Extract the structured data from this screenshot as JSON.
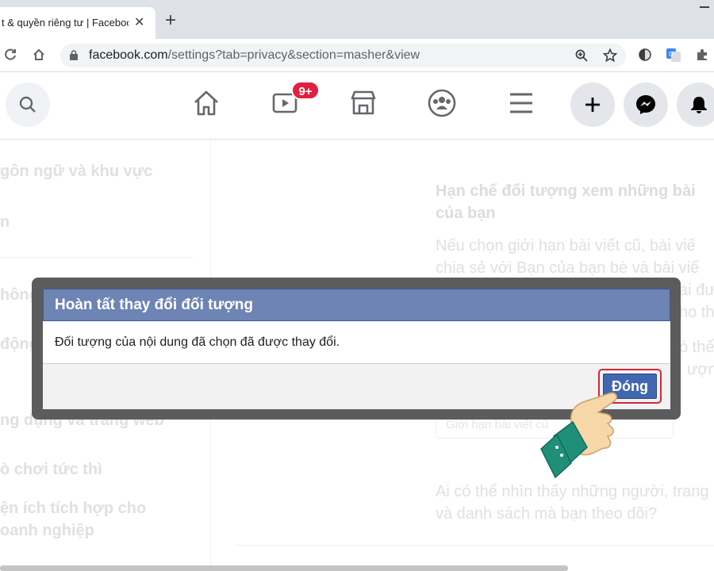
{
  "browser": {
    "tab_title": "t & quyền riêng tư | Facebook",
    "new_tab": "+",
    "url_host": "facebook.com",
    "url_path": "/settings?tab=privacy&section=masher&view"
  },
  "header": {
    "badge": "9+"
  },
  "sidebar": {
    "items": [
      "gôn ngữ và khu vực",
      "n",
      "hông",
      "động",
      "ng dụng và trang web",
      "ò chơi tức thì",
      "ện ích tích hợp cho",
      "oanh nghiệp"
    ]
  },
  "main": {
    "heading_line1": "Hạn chế đối tượng xem những bài",
    "heading_line2": "của bạn",
    "desc_line1": "Nếu chọn giới hạn bài viết cũ, bài viế",
    "desc_line2": "chia sẻ với Bạn của bạn bè và bài viế",
    "frag1": "ai đư",
    "frag2": "ho th",
    "frag3": "ó thể",
    "frag4": "ượn",
    "select_label": "Giới hạn bài viết cũ",
    "question_line1": "Ai có thể nhìn thấy những người, trang",
    "question_line2": "và danh sách mà bạn theo dõi?"
  },
  "dialog": {
    "title": "Hoàn tất thay đổi đối tượng",
    "message": "Đối tượng của nội dung đã chọn đã được thay đổi.",
    "close_label": "Đóng"
  },
  "colors": {
    "dialog_header": "#6d84b4",
    "button": "#4267b2",
    "highlight": "#d4283a",
    "badge": "#e41e3f"
  }
}
